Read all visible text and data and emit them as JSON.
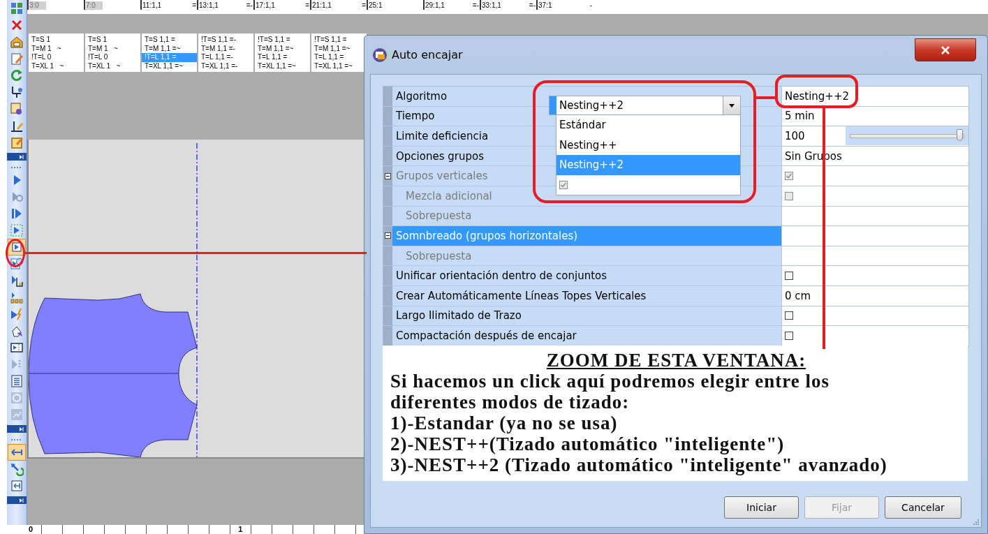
{
  "toolbar": {
    "groups": [
      {
        "tools": [
          {
            "kind": "grid",
            "selected": false
          },
          {
            "kind": "close",
            "selected": false
          },
          {
            "kind": "house",
            "selected": false
          },
          {
            "kind": "edit",
            "selected": false
          },
          {
            "kind": "refresh",
            "selected": false
          },
          {
            "kind": "wrench",
            "selected": false
          },
          {
            "kind": "doc",
            "selected": false
          },
          {
            "kind": "ruler",
            "selected": false
          },
          {
            "kind": "note",
            "selected": false
          }
        ]
      },
      {
        "tools": [
          {
            "kind": "play",
            "selected": false
          },
          {
            "kind": "play-dim",
            "selected": false
          },
          {
            "kind": "play-bar",
            "selected": false
          },
          {
            "kind": "play-dashed",
            "selected": false
          },
          {
            "kind": "play-box",
            "selected": true
          },
          {
            "kind": "clock",
            "selected": false
          },
          {
            "kind": "bars",
            "selected": false
          },
          {
            "kind": "bars3",
            "selected": false
          },
          {
            "kind": "bolt",
            "selected": false
          },
          {
            "kind": "hand",
            "selected": false
          },
          {
            "kind": "frame",
            "selected": false
          },
          {
            "kind": "play-dim-bars",
            "selected": false
          },
          {
            "kind": "list",
            "selected": false
          },
          {
            "kind": "disc",
            "selected": false
          },
          {
            "kind": "chart",
            "selected": false
          }
        ]
      },
      {
        "tools": [
          {
            "kind": "arrow",
            "selected": true
          },
          {
            "kind": "cycle",
            "selected": false
          },
          {
            "kind": "export",
            "selected": false
          }
        ]
      }
    ]
  },
  "ruler": {
    "segments": [
      {
        "label": "3:0",
        "dimmed": true
      },
      {
        "label": "7:0",
        "dimmed": true
      },
      {
        "label": "11:1,1",
        "mark": "=",
        "dimmed": false
      },
      {
        "label": "13:1,1",
        "mark": "=-",
        "dimmed": false
      },
      {
        "label": "17:1,1",
        "mark": "=",
        "dimmed": false
      },
      {
        "label": "21:1,1",
        "mark": "=",
        "dimmed": false
      },
      {
        "label": "25:1",
        "dimmed": false
      },
      {
        "label": "29:1,1",
        "mark": "=-",
        "dimmed": false
      },
      {
        "label": "33:1,1",
        "mark": "=-",
        "dimmed": false
      },
      {
        "label": "37:1",
        "mark": "-",
        "dimmed": false
      }
    ]
  },
  "size_table": {
    "columns": [
      {
        "entries": [
          {
            "text": "T=S 1",
            "selected": false
          },
          {
            "text": "T=M 1   ~",
            "selected": false
          },
          {
            "text": "!T=L 0",
            "selected": false
          },
          {
            "text": "T=XL 1   ~",
            "selected": false
          }
        ]
      },
      {
        "entries": [
          {
            "text": "T=S 1",
            "selected": false
          },
          {
            "text": "T=M 1   ~",
            "selected": false
          },
          {
            "text": "!T=L 0",
            "selected": false
          },
          {
            "text": "T=XL 1   ~",
            "selected": false
          }
        ]
      },
      {
        "entries": [
          {
            "text": "T=S 1,1 =",
            "selected": false
          },
          {
            "text": "T=M 1,1 =~",
            "selected": false
          },
          {
            "text": "!T=L 1,1 =",
            "selected": true
          },
          {
            "text": "T=XL 1,1 =~",
            "selected": false
          }
        ]
      },
      {
        "entries": [
          {
            "text": "!T=S 1,1 =-",
            "selected": false
          },
          {
            "text": "T=M 1,1 =-",
            "selected": false
          },
          {
            "text": "T=L 1,1 =-",
            "selected": false
          },
          {
            "text": "T=XL 1,1 =-",
            "selected": false
          }
        ]
      },
      {
        "entries": [
          {
            "text": "!T=S 1,1 =",
            "selected": false
          },
          {
            "text": "T=M 1,1 =~",
            "selected": false
          },
          {
            "text": "T=L 1,1 =",
            "selected": false
          },
          {
            "text": "T=XL 1,1 =~",
            "selected": false
          }
        ]
      },
      {
        "entries": [
          {
            "text": "!T=S 1,1 =",
            "selected": false
          },
          {
            "text": "T=M 1,1 =~",
            "selected": false
          },
          {
            "text": "T=L 1,1 =",
            "selected": false
          },
          {
            "text": "T=XL 1,1 =~",
            "selected": false
          }
        ]
      }
    ]
  },
  "bottom_ruler": {
    "labels": [
      "0",
      "1"
    ]
  },
  "dialog": {
    "title": "Auto encajar",
    "properties": [
      {
        "label": "Algoritmo",
        "kind": "text",
        "value": "Nesting++2",
        "disabled": false,
        "selected": false
      },
      {
        "label": "Tiempo",
        "kind": "text",
        "value": "5 min",
        "disabled": false,
        "selected": false
      },
      {
        "label": "Limite deficiencia",
        "kind": "slider",
        "value": "100",
        "level": 1,
        "disabled": false,
        "selected": false
      },
      {
        "label": "Opciones grupos",
        "kind": "text",
        "value": "Sin Grupos",
        "disabled": false,
        "selected": false
      },
      {
        "label": "Grupos verticales",
        "kind": "checkbox",
        "checked": true,
        "disabled": true,
        "selected": false,
        "expanded": true,
        "children": [
          {
            "label": "Mezcla adicional",
            "kind": "checkbox",
            "checked": false,
            "disabled": true,
            "selected": false
          },
          {
            "label": "Sobrepuesta",
            "kind": "empty",
            "disabled": true,
            "selected": false
          }
        ]
      },
      {
        "label": "Somnbreado (grupos horizontales)",
        "kind": "empty",
        "disabled": false,
        "selected": true,
        "expanded": true,
        "children": [
          {
            "label": "Sobrepuesta",
            "kind": "empty",
            "disabled": true,
            "selected": false
          }
        ]
      },
      {
        "label": "Unificar orientación dentro de conjuntos",
        "kind": "checkbox",
        "checked": false,
        "disabled": false,
        "selected": false
      },
      {
        "label": "Crear Automáticamente Líneas Topes Verticales",
        "kind": "text",
        "value": "0 cm",
        "disabled": false,
        "selected": false
      },
      {
        "label": "Largo Ilimitado de Trazo",
        "kind": "checkbox",
        "checked": false,
        "disabled": false,
        "selected": false
      },
      {
        "label": "Compactación después de encajar",
        "kind": "checkbox",
        "checked": false,
        "disabled": false,
        "selected": false
      }
    ],
    "dropdown": {
      "value": "Nesting++2",
      "options": [
        {
          "label": "Estándar",
          "selected": false
        },
        {
          "label": "Nesting++",
          "selected": false
        },
        {
          "label": "Nesting++2",
          "selected": true
        }
      ],
      "checkbox": {
        "checked": true,
        "disabled": true
      }
    },
    "note": {
      "title": "ZOOM DE ESTA VENTANA:",
      "intro": [
        "Si hacemos un click aquí podremos elegir entre los",
        "diferentes modos de tizado:"
      ],
      "items": [
        "1)-Estandar (ya no se usa)",
        "2)-NEST++(Tizado automático \"inteligente\")",
        "3)-NEST++2 (Tizado automático \"inteligente\" avanzado)"
      ]
    },
    "buttons": [
      {
        "label": "Iniciar",
        "disabled": false
      },
      {
        "label": "Fijar",
        "disabled": true
      },
      {
        "label": "Cancelar",
        "disabled": false
      }
    ]
  }
}
